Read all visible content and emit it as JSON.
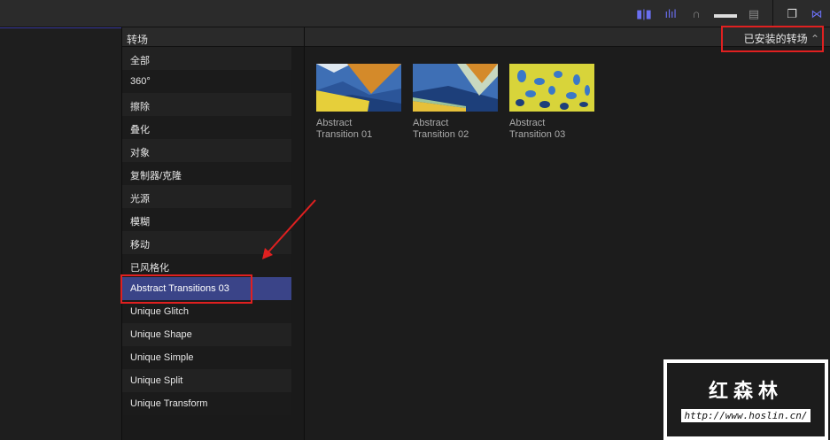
{
  "toolbar": {
    "icons": [
      "video-audio-split-icon",
      "waveform-icon",
      "headphones-icon",
      "clip-appearance-icon",
      "filmstrip-icon",
      "window-icon",
      "transitions-icon"
    ]
  },
  "sidebar": {
    "title": "转场",
    "items": [
      {
        "label": "全部"
      },
      {
        "label": "360°"
      },
      {
        "label": "擦除"
      },
      {
        "label": "叠化"
      },
      {
        "label": "对象"
      },
      {
        "label": "复制器/克隆"
      },
      {
        "label": "光源"
      },
      {
        "label": "模糊"
      },
      {
        "label": "移动"
      },
      {
        "label": "已风格化"
      },
      {
        "label": "Abstract Transitions 03",
        "selected": true
      },
      {
        "label": "Unique Glitch"
      },
      {
        "label": "Unique Shape"
      },
      {
        "label": "Unique Simple"
      },
      {
        "label": "Unique Split"
      },
      {
        "label": "Unique Transform"
      }
    ]
  },
  "main": {
    "dropdown": "已安装的转场",
    "tiles": [
      {
        "line1": "Abstract",
        "line2": "Transition 01"
      },
      {
        "line1": "Abstract",
        "line2": "Transition 02"
      },
      {
        "line1": "Abstract",
        "line2": "Transition 03"
      }
    ]
  },
  "watermark": {
    "title": "红森林",
    "url": "http://www.hoslin.cn/"
  },
  "colors": {
    "selection": "#3a4488",
    "annotation": "#e02020",
    "accent": "#6a6ff0"
  }
}
